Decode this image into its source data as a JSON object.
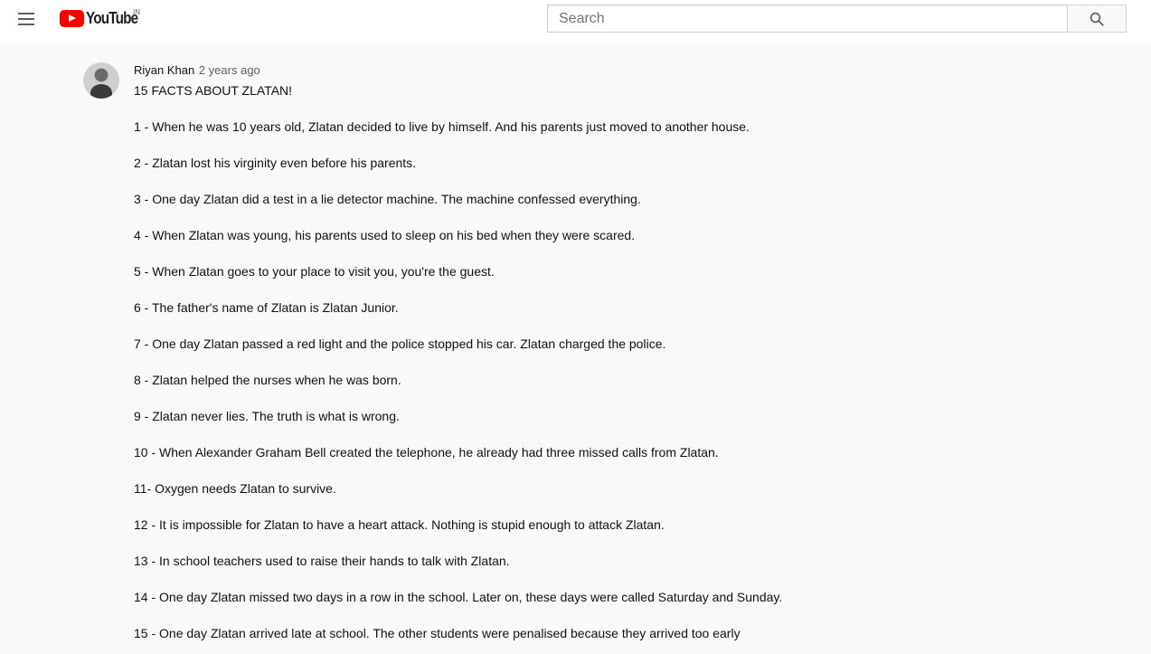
{
  "header": {
    "logo_text": "YouTube",
    "logo_region": "IN",
    "search": {
      "placeholder": "Search",
      "value": ""
    }
  },
  "comment": {
    "author": "Riyan Khan",
    "time": "2 years ago",
    "title": "15 FACTS ABOUT ZLATAN!",
    "facts": [
      "1 - When he was 10 years old, Zlatan decided to live by himself. And his parents just moved to another house.",
      "2 - Zlatan lost his virginity even before his parents.",
      "3 - One day Zlatan did a test in a lie detector machine. The machine confessed everything.",
      "4 - When Zlatan was young, his parents used to sleep on his bed when they were scared.",
      "5 - When Zlatan goes to your place to visit you, you're the guest.",
      "6 - The father's name of Zlatan is Zlatan Junior.",
      "7 - One day Zlatan passed a red light and the police stopped his car. Zlatan charged the police.",
      "8 - Zlatan helped the nurses when he was born.",
      "9 - Zlatan never lies. The truth is what is wrong.",
      "10 - When Alexander Graham Bell created the telephone, he already had three missed calls from Zlatan.",
      "11- Oxygen needs Zlatan to survive.",
      "12 - It is impossible for Zlatan to have a heart attack. Nothing is stupid enough to attack Zlatan.",
      "13 - In school teachers used to raise their hands to talk with Zlatan.",
      "14 - One day Zlatan missed two days in a row in the school. Later on, these days were called Saturday and Sunday.",
      "15 - One day Zlatan arrived late at school. The other students were penalised because they arrived too early"
    ]
  },
  "icons": {
    "menu": "hamburger-menu-icon",
    "logo": "youtube-logo-icon",
    "search": "search-icon"
  },
  "colors": {
    "brand_red": "#ff0000",
    "page_background": "#f9f9f9",
    "header_background": "#ffffff",
    "secondary_text": "#606060"
  }
}
